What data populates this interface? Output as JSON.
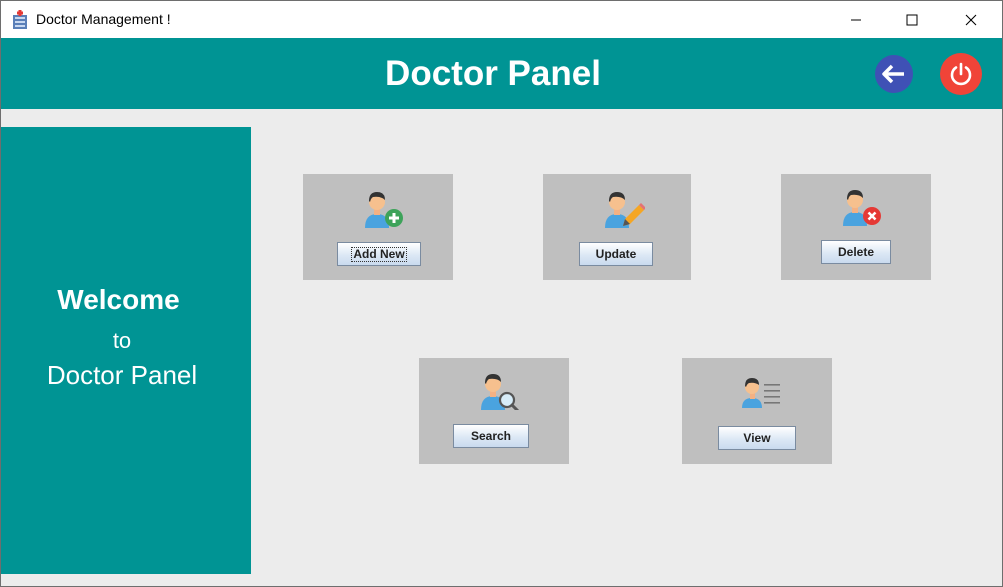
{
  "window": {
    "title": "Doctor Management !"
  },
  "header": {
    "title": "Doctor Panel",
    "back_icon": "arrow-left-icon",
    "power_icon": "power-icon",
    "back_color": "#3f51b5",
    "power_color": "#f04438",
    "accent": "#009494"
  },
  "sidebar": {
    "welcome": "Welcome",
    "to": "to",
    "panel": "Doctor Panel"
  },
  "tiles": [
    {
      "label": "Add New",
      "icon": "add-user-icon"
    },
    {
      "label": "Update",
      "icon": "edit-user-icon"
    },
    {
      "label": "Delete",
      "icon": "delete-user-icon"
    },
    {
      "label": "Search",
      "icon": "search-user-icon"
    },
    {
      "label": "View",
      "icon": "view-user-icon"
    }
  ]
}
